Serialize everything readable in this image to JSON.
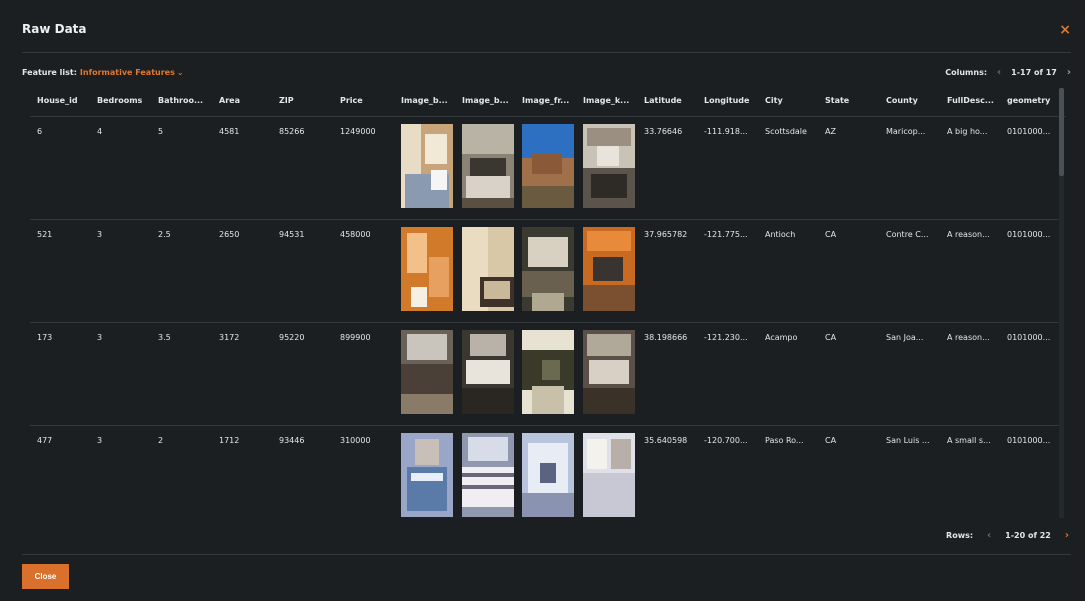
{
  "dialog": {
    "title": "Raw Data",
    "close_icon": "×"
  },
  "feature_list": {
    "label": "Feature list:",
    "value": "Informative Features",
    "chevron": "⌄"
  },
  "columns_pager": {
    "label": "Columns:",
    "prev": "‹",
    "range": "1-17 of 17",
    "next": "›"
  },
  "table": {
    "headers": [
      "House_id",
      "Bedrooms",
      "Bathroo...",
      "Area",
      "ZIP",
      "Price",
      "Image_b...",
      "Image_b...",
      "Image_fr...",
      "Image_k...",
      "Latitude",
      "Longitude",
      "City",
      "State",
      "County",
      "FullDesc...",
      "geometry"
    ],
    "rows": [
      {
        "house_id": "6",
        "bedrooms": "4",
        "bathrooms": "5",
        "area": "4581",
        "zip": "85266",
        "price": "1249000",
        "latitude": "33.76646",
        "longitude": "-111.918...",
        "city": "Scottsdale",
        "state": "AZ",
        "county": "Maricop...",
        "fulldesc": "A big ho...",
        "geometry": "0101000..."
      },
      {
        "house_id": "521",
        "bedrooms": "3",
        "bathrooms": "2.5",
        "area": "2650",
        "zip": "94531",
        "price": "458000",
        "latitude": "37.965782",
        "longitude": "-121.775...",
        "city": "Antioch",
        "state": "CA",
        "county": "Contre C...",
        "fulldesc": "A reason...",
        "geometry": "0101000..."
      },
      {
        "house_id": "173",
        "bedrooms": "3",
        "bathrooms": "3.5",
        "area": "3172",
        "zip": "95220",
        "price": "899900",
        "latitude": "38.198666",
        "longitude": "-121.230...",
        "city": "Acampo",
        "state": "CA",
        "county": "San Joa...",
        "fulldesc": "A reason...",
        "geometry": "0101000..."
      },
      {
        "house_id": "477",
        "bedrooms": "3",
        "bathrooms": "2",
        "area": "1712",
        "zip": "93446",
        "price": "310000",
        "latitude": "35.640598",
        "longitude": "-120.700...",
        "city": "Paso Ro...",
        "state": "CA",
        "county": "San Luis ...",
        "fulldesc": "A small s...",
        "geometry": "0101000..."
      }
    ]
  },
  "rows_pager": {
    "label": "Rows:",
    "prev": "‹",
    "range": "1-20 of 22",
    "next": "›"
  },
  "footer": {
    "close_label": "Close"
  },
  "colors": {
    "accent": "#e0782e",
    "background": "#1b1f22",
    "divider": "#33393d"
  }
}
